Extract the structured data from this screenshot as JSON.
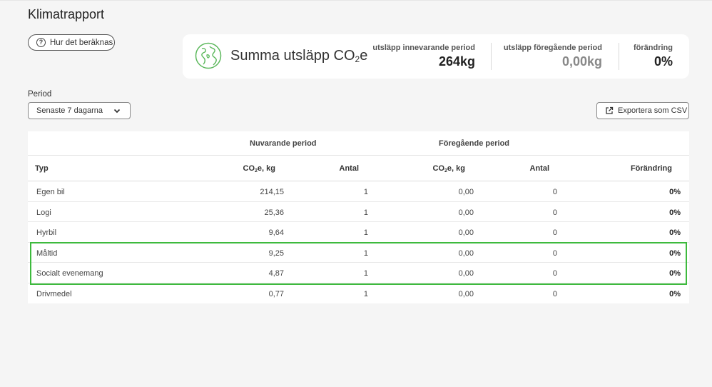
{
  "page": {
    "title": "Klimatrapport"
  },
  "how_button": {
    "label": "Hur det beräknas",
    "icon": "question-circle-icon"
  },
  "summary": {
    "title_prefix": "Summa utsläpp CO",
    "title_sub": "2",
    "title_suffix": "e",
    "icon": "globe-icon",
    "accent_color": "#5cb85c",
    "current": {
      "label": "utsläpp innevarande period",
      "value": "264kg"
    },
    "previous": {
      "label": "utsläpp föregående period",
      "value": "0,00kg"
    },
    "change": {
      "label": "förändring",
      "value": "0%"
    }
  },
  "period": {
    "label": "Period",
    "selected": "Senaste 7 dagarna"
  },
  "export_button": {
    "label": "Exportera som CSV",
    "icon": "external-link-icon"
  },
  "table": {
    "group_current": "Nuvarande period",
    "group_previous": "Föregående period",
    "headers": {
      "type": "Typ",
      "co2_prefix": "CO",
      "co2_sub": "2",
      "co2_suffix": "e, kg",
      "antal": "Antal",
      "change": "Förändring"
    },
    "rows": [
      {
        "type": "Egen bil",
        "co2": "214,15",
        "antal": "1",
        "prev_co2": "0,00",
        "prev_antal": "0",
        "change": "0%"
      },
      {
        "type": "Logi",
        "co2": "25,36",
        "antal": "1",
        "prev_co2": "0,00",
        "prev_antal": "0",
        "change": "0%"
      },
      {
        "type": "Hyrbil",
        "co2": "9,64",
        "antal": "1",
        "prev_co2": "0,00",
        "prev_antal": "0",
        "change": "0%"
      },
      {
        "type": "Måltid",
        "co2": "9,25",
        "antal": "1",
        "prev_co2": "0,00",
        "prev_antal": "0",
        "change": "0%"
      },
      {
        "type": "Socialt evenemang",
        "co2": "4,87",
        "antal": "1",
        "prev_co2": "0,00",
        "prev_antal": "0",
        "change": "0%"
      },
      {
        "type": "Drivmedel",
        "co2": "0,77",
        "antal": "1",
        "prev_co2": "0,00",
        "prev_antal": "0",
        "change": "0%"
      }
    ],
    "highlight_color": "#3dba3d"
  }
}
